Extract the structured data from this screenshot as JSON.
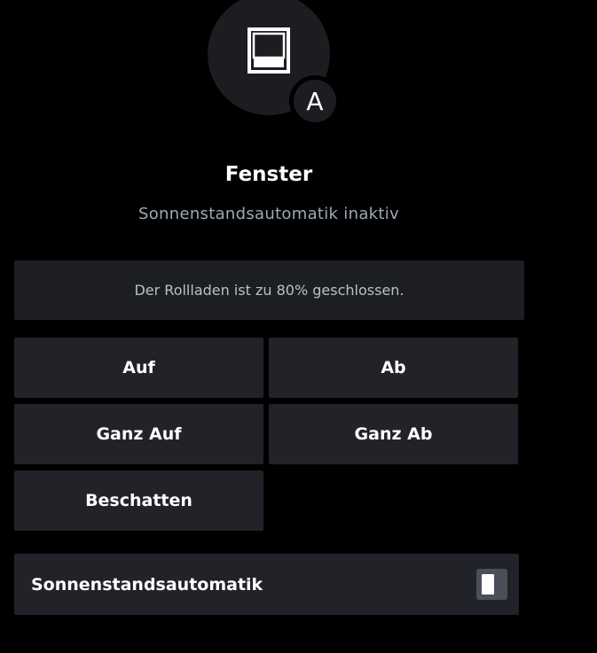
{
  "device": {
    "icon": "roller-shutter-icon",
    "mode_badge": "A",
    "title": "Fenster",
    "subtitle": "Sonnenstandsautomatik inaktiv"
  },
  "status": {
    "message": "Der Rollladen ist zu 80% geschlossen.",
    "closed_percent": 80
  },
  "controls": {
    "up_label": "Auf",
    "down_label": "Ab",
    "full_up_label": "Ganz Auf",
    "full_down_label": "Ganz Ab",
    "shade_label": "Beschatten"
  },
  "automation": {
    "label": "Sonnenstandsautomatik",
    "enabled": false
  },
  "colors": {
    "background": "#000000",
    "card": "#212328",
    "subtitle": "#9ea8b6",
    "status_text": "#b9c0ca"
  }
}
